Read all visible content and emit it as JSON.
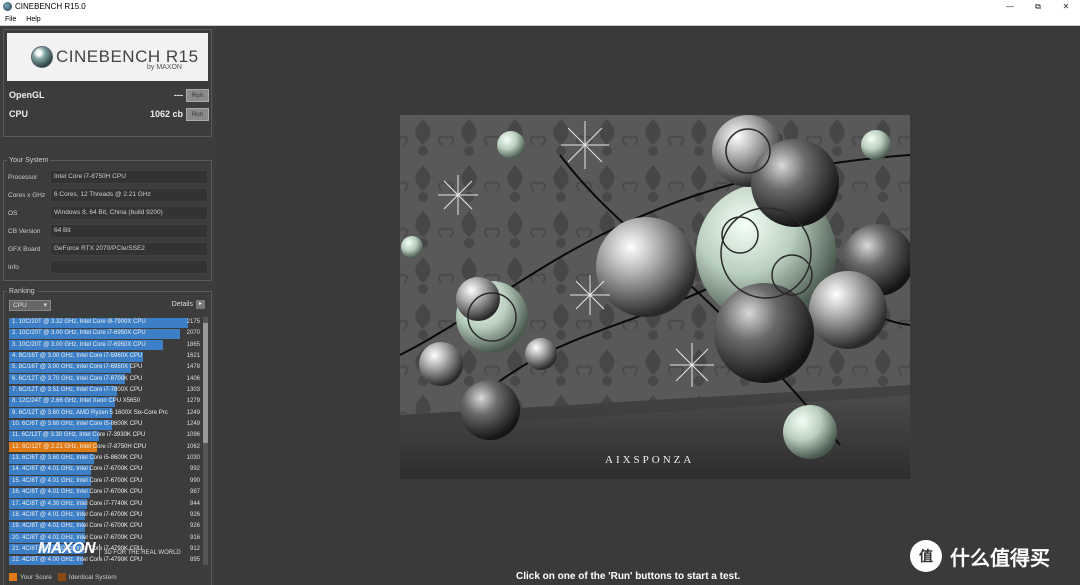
{
  "window": {
    "title": "CINEBENCH R15.0",
    "minimize": "—",
    "restore": "⧉",
    "close": "✕"
  },
  "menu": [
    "File",
    "Help"
  ],
  "header": {
    "logo_text": "CINEBENCH R15",
    "logo_sub": "by MAXON",
    "opengl_label": "OpenGL",
    "opengl_value": "---",
    "cpu_label": "CPU",
    "cpu_value": "1062 cb",
    "run_label": "Run"
  },
  "system": {
    "title": "Your System",
    "rows": [
      {
        "key": "Processor",
        "value": "Intel Core i7-8750H CPU"
      },
      {
        "key": "Cores x GHz",
        "value": "6 Cores, 12 Threads @ 2.21 GHz"
      },
      {
        "key": "OS",
        "value": "Windows 8, 64 Bit, China (build 9200)"
      },
      {
        "key": "CB Version",
        "value": "64 Bit"
      },
      {
        "key": "GFX Board",
        "value": "GeForce RTX 2070/PCIe/SSE2"
      },
      {
        "key": "Info",
        "value": ""
      }
    ]
  },
  "ranking": {
    "title": "Ranking",
    "dropdown": "CPU",
    "details": "Details",
    "items": [
      {
        "label": "1. 10C/20T @ 3.32 GHz, Intel Core i9-7900X CPU",
        "score": 2175
      },
      {
        "label": "2. 10C/20T @ 3.00 GHz, Intel Core i7-6950X CPU",
        "score": 2070
      },
      {
        "label": "3. 10C/20T @ 3.00 GHz, Intel Core i7-6950X CPU",
        "score": 1865
      },
      {
        "label": "4. 8C/16T @ 3.00 GHz, Intel Core i7-5960X CPU",
        "score": 1621
      },
      {
        "label": "5. 8C/16T @ 3.00 GHz, Intel Core i7-6950X CPU",
        "score": 1478
      },
      {
        "label": "6. 6C/12T @ 3.70 GHz, Intel Core i7-8700K CPU",
        "score": 1406
      },
      {
        "label": "7. 6C/12T @ 3.51 GHz, Intel Core i7-7800X CPU",
        "score": 1303
      },
      {
        "label": "8. 12C/24T @ 2.66 GHz, Intel Xeon CPU X5650",
        "score": 1279
      },
      {
        "label": "9. 6C/12T @ 3.60 GHz, AMD Ryzen 5 1600X Six-Core Prc",
        "score": 1249
      },
      {
        "label": "10. 6C/6T @ 3.60 GHz, Intel Core i5-8600K CPU",
        "score": 1249
      },
      {
        "label": "11. 6C/12T @ 3.30 GHz,  Intel Core i7-3930K CPU",
        "score": 1096
      },
      {
        "label": "12. 6C/12T @ 2.21 GHz, Intel Core i7-8750H CPU",
        "score": 1062,
        "mine": true
      },
      {
        "label": "13. 6C/6T @ 3.60 GHz, Intel Core i5-8600K CPU",
        "score": 1030
      },
      {
        "label": "14. 4C/8T @ 4.01 GHz, Intel Core i7-6700K CPU",
        "score": 992
      },
      {
        "label": "15. 4C/8T @ 4.01 GHz, Intel Core i7-6700K CPU",
        "score": 990
      },
      {
        "label": "16. 4C/8T @ 4.01 GHz, Intel Core i7-6700K CPU",
        "score": 987
      },
      {
        "label": "17. 4C/8T @ 4.30 GHz, Intel Core i7-7740K CPU",
        "score": 944
      },
      {
        "label": "18. 4C/8T @ 4.01 GHz, Intel Core i7-6700K CPU",
        "score": 926
      },
      {
        "label": "19. 4C/8T @ 4.01 GHz, Intel Core i7-6700K CPU",
        "score": 926
      },
      {
        "label": "20. 4C/8T @ 4.01 GHz, Intel Core i7-6700K CPU",
        "score": 916
      },
      {
        "label": "21. 4C/8T @ 4.01 GHz, Intel Core i7-4790K CPU",
        "score": 912
      },
      {
        "label": "22. 4C/8T @ 4.00 GHz, Intel Core i7-4790K CPU",
        "score": 895
      }
    ],
    "legend_your": "Your Score",
    "legend_identical": "Identical System",
    "color_bar": "#3c7fc7",
    "color_mine": "#e07b12",
    "color_identical": "#8a4a12"
  },
  "footer": {
    "maxon": "MAXON",
    "tagline": "3D FOR THE REAL WORLD"
  },
  "render": {
    "brand": "AIXSPONZA"
  },
  "status": "Click on one of the 'Run' buttons to start a test.",
  "watermark": {
    "icon": "值",
    "text": "什么值得买"
  }
}
